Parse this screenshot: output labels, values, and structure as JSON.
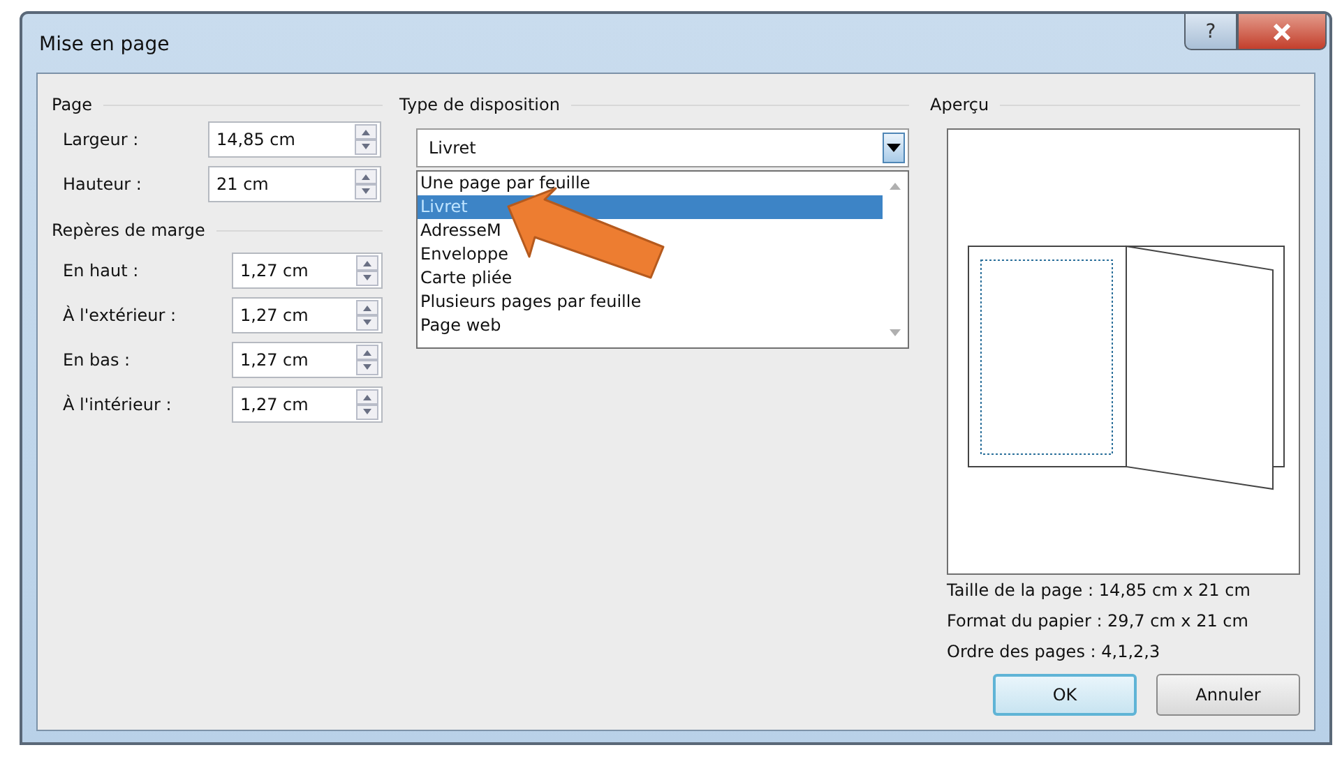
{
  "window": {
    "title": "Mise en page",
    "title_buttons": [
      {
        "kind": "help",
        "label": "?"
      },
      {
        "kind": "close"
      }
    ]
  },
  "page": {
    "title": "Page",
    "fields": [
      {
        "label": "Largeur :",
        "value": "14,85 cm"
      },
      {
        "label": "Hauteur :",
        "value": "21 cm"
      }
    ]
  },
  "margins": {
    "title": "Repères de marge",
    "fields": [
      {
        "label": "En haut :",
        "value": "1,27 cm"
      },
      {
        "label": "À l'extérieur :",
        "value": "1,27 cm"
      },
      {
        "label": "En bas :",
        "value": "1,27 cm"
      },
      {
        "label": "À l'intérieur :",
        "value": "1,27 cm"
      }
    ]
  },
  "layout": {
    "title": "Type de disposition",
    "value": "Livret",
    "options": [
      {
        "label": "Une page par feuille",
        "selected": false
      },
      {
        "label": "Livret",
        "selected": true
      },
      {
        "label": "AdresseM",
        "selected": false
      },
      {
        "label": "Enveloppe",
        "selected": false
      },
      {
        "label": "Carte pliée",
        "selected": false
      },
      {
        "label": "Plusieurs pages par feuille",
        "selected": false
      },
      {
        "label": "Page web",
        "selected": false
      }
    ]
  },
  "preview": {
    "title": "Aperçu",
    "info": [
      "Taille de la page : 14,85 cm x 21 cm",
      "Format du papier : 29,7 cm x 21 cm",
      "Ordre des pages : 4,1,2,3"
    ]
  },
  "buttons": [
    {
      "label": "OK",
      "default": true
    },
    {
      "label": "Annuler",
      "default": false
    }
  ],
  "annotations": [
    {
      "kind": "arrow"
    }
  ]
}
